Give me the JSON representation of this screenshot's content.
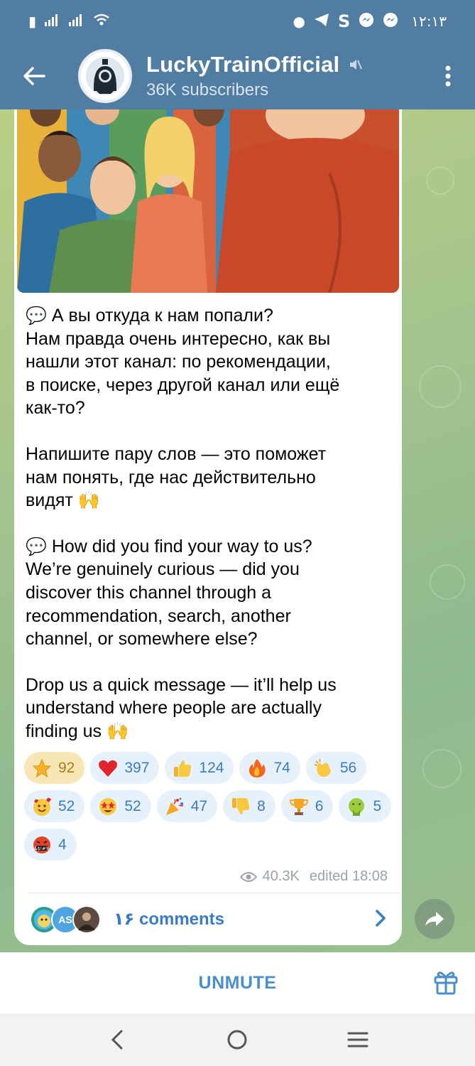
{
  "status_bar": {
    "time": "۱۲:۱۳",
    "carrier_icons": [
      "sim-icon",
      "signal-icon",
      "signal-icon",
      "wifi-icon"
    ],
    "notif_icons": [
      "dot-icon",
      "telegram-icon",
      "s-icon",
      "messenger-icon",
      "messenger-icon"
    ]
  },
  "header": {
    "title": "LuckyTrainOfficial",
    "subtitle": "36K subscribers",
    "muted_icon": "muted-speaker-icon"
  },
  "message": {
    "paragraphs": [
      {
        "emoji": "💬",
        "lines": [
          "А вы откуда к нам попали?",
          "Нам правда очень интересно, как вы",
          "нашли этот канал: по рекомендации,",
          "в поиске, через другой канал или ещё",
          "как-то?"
        ]
      },
      {
        "emoji": "",
        "lines": [
          "Напишите пару слов — это поможет",
          "нам понять, где нас действительно",
          "видят 🙌"
        ]
      },
      {
        "emoji": "💬",
        "lines": [
          "How did you find your way to us?",
          "We’re genuinely curious — did you",
          "discover this channel through a",
          "recommendation, search, another",
          "channel, or somewhere else?"
        ]
      },
      {
        "emoji": "",
        "lines": [
          "Drop us a quick message — it’ll help us",
          "understand where people are actually",
          "finding us 🙌"
        ]
      }
    ]
  },
  "reactions": [
    {
      "icon": "star-icon",
      "count": "92",
      "active": true
    },
    {
      "icon": "heart-icon",
      "count": "397"
    },
    {
      "icon": "thumbs-up-icon",
      "count": "124"
    },
    {
      "icon": "fire-icon",
      "count": "74"
    },
    {
      "icon": "clapping-icon",
      "count": "56"
    },
    {
      "icon": "smiling-hearts-icon",
      "count": "52"
    },
    {
      "icon": "star-struck-icon",
      "count": "52"
    },
    {
      "icon": "party-popper-icon",
      "count": "47"
    },
    {
      "icon": "thumbs-down-icon",
      "count": "8"
    },
    {
      "icon": "trophy-icon",
      "count": "6"
    },
    {
      "icon": "nauseated-icon",
      "count": "5"
    },
    {
      "icon": "cursing-face-icon",
      "count": "4"
    }
  ],
  "meta": {
    "views": "40.3K",
    "edited": "edited 18:08"
  },
  "comments": {
    "label": "۱۶ comments",
    "avatar_initials": "AS"
  },
  "bottom": {
    "unmute_label": "UNMUTE"
  },
  "colors": {
    "header": "#517da2",
    "accent": "#3a7cc4",
    "reaction_bg": "#e6f1fb",
    "reaction_active_bg": "#f8e6b4"
  }
}
